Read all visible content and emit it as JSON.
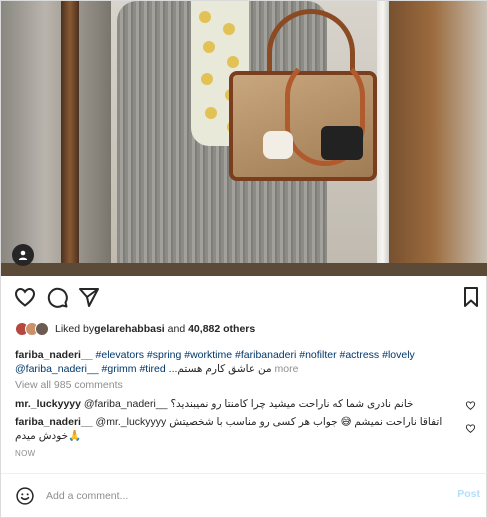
{
  "post": {
    "image_alt": "Mirror selfie in an elevator with a grey knit coat, emoji-print scarf and a monogram handbag"
  },
  "likes": {
    "prefix": "Liked by ",
    "user": "gelarehabbasi",
    "middle": " and ",
    "count": "40,882 others"
  },
  "caption": {
    "user": "fariba_naderi__",
    "tags": " #elevators #spring #worktime #faribanaderi #nofilter #actress #lovely @fariba_naderi__ #grimm #tired",
    "persian": "من عاشق کارم هستم...",
    "more": " more"
  },
  "view_all_comments": "View all 985 comments",
  "comments": [
    {
      "user": "mr._luckyyyy",
      "text": " @fariba_naderi__ خانم نادری شما که ناراحت میشید چرا کامنتا رو نمیبندید؟"
    },
    {
      "user": "fariba_naderi__",
      "text": " @mr._luckyyyy اتفاقا ناراحت نمیشم 😅 جواب هر کسی رو مناسب با شخصیتش خودش میدم🙏"
    }
  ],
  "timestamp": "NOW",
  "comment_box": {
    "placeholder": "Add a comment...",
    "post_label": "Post"
  },
  "colors": {
    "link": "#00376b",
    "muted": "#8e8e8e",
    "post_disabled": "#b2dffc"
  }
}
